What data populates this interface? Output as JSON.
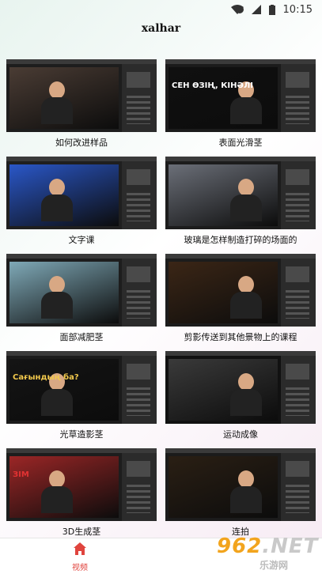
{
  "status": {
    "time": "10:15"
  },
  "app": {
    "title": "xalhar"
  },
  "items": [
    {
      "caption": "如何改进样品",
      "bg": "#1d1d1d",
      "scene": "#4a3c34"
    },
    {
      "caption": "表面光滑茎",
      "bg": "#1b1b1b",
      "scene": "#101010",
      "overlay": "СЕН ӨЗІҢ, КІНӘЛІ",
      "overlay_color": "#ffffff"
    },
    {
      "caption": "文字课",
      "bg": "#1f1f1f",
      "scene": "#2a57c8"
    },
    {
      "caption": "玻璃是怎样制造打碎的场面的",
      "bg": "#1c1c1c",
      "scene": "#6b6f78"
    },
    {
      "caption": "面部减肥茎",
      "bg": "#1d1d1d",
      "scene": "#7fa9b7"
    },
    {
      "caption": "剪影传送到其他景物上的课程",
      "bg": "#1c1c1c",
      "scene": "#3b2616"
    },
    {
      "caption": "光草造影茎",
      "bg": "#1b1b1b",
      "scene": "#141414",
      "overlay": "Сағындың ба?",
      "overlay_color": "#f2c94c"
    },
    {
      "caption": "运动成像",
      "bg": "#111111",
      "scene": "#3a3a3a"
    },
    {
      "caption": "3D生成茎",
      "bg": "#1d1d1d",
      "scene": "#9b2626",
      "overlay": "ЗІМ",
      "overlay_color": "#e23232"
    },
    {
      "caption": "连拍",
      "bg": "#1b1b1b",
      "scene": "#2a1f14"
    }
  ],
  "nav": {
    "home_label": "视频"
  },
  "watermark": {
    "brand": "962.NET",
    "sub": "乐游网"
  },
  "colors": {
    "accent": "#e0443e",
    "watermark_orange": "#f2a41d"
  }
}
